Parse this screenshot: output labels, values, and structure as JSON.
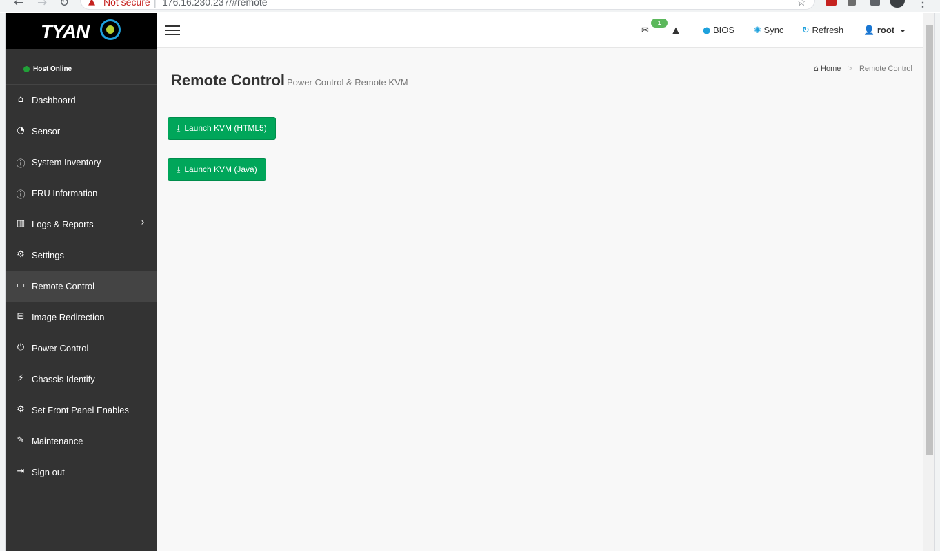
{
  "browser": {
    "security_warning": "Not secure",
    "url": "176.16.230.237/#remote"
  },
  "sidebar": {
    "brand": "TYAN",
    "host_status": "Host Online",
    "items": [
      {
        "label": "Dashboard",
        "icon": "home-icon"
      },
      {
        "label": "Sensor",
        "icon": "dashboard-gauge-icon"
      },
      {
        "label": "System Inventory",
        "icon": "info-icon"
      },
      {
        "label": "FRU Information",
        "icon": "info-icon"
      },
      {
        "label": "Logs & Reports",
        "icon": "bar-chart-icon"
      },
      {
        "label": "Settings",
        "icon": "gear-icon"
      },
      {
        "label": "Remote Control",
        "icon": "desktop-icon",
        "active": true
      },
      {
        "label": "Image Redirection",
        "icon": "hdd-icon"
      },
      {
        "label": "Power Control",
        "icon": "power-icon"
      },
      {
        "label": "Chassis Identify",
        "icon": "plug-icon"
      },
      {
        "label": "Set Front Panel Enables",
        "icon": "gears-icon"
      },
      {
        "label": "Maintenance",
        "icon": "wrench-icon"
      },
      {
        "label": "Sign out",
        "icon": "sign-out-icon"
      }
    ]
  },
  "header": {
    "notification_count": "1",
    "bios_label": "BIOS",
    "sync_label": "Sync",
    "refresh_label": "Refresh",
    "user_label": "root"
  },
  "main": {
    "title": "Remote Control",
    "subtitle": "Power Control & Remote KVM",
    "breadcrumb_home": "Home",
    "breadcrumb_current": "Remote Control",
    "buttons": {
      "launch_html5": "Launch KVM (HTML5)",
      "launch_java": "Launch KVM (Java)"
    }
  },
  "colors": {
    "sidebar_bg": "#333333",
    "active_item_bg": "#444444",
    "button_green": "#00a65a",
    "status_online": "#21a038",
    "badge_green": "#5cb85c",
    "info_blue": "#1ea1dc"
  }
}
